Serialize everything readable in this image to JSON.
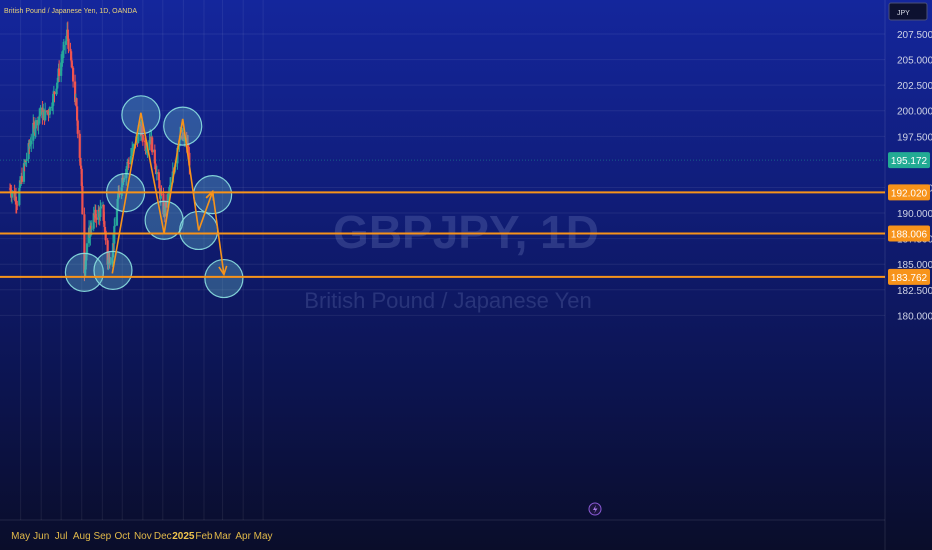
{
  "title": "British Pound / Japanese Yen, 1D, OANDA",
  "watermark": {
    "symbol": "GBPJPY, 1D",
    "name": "British Pound / Japanese Yen"
  },
  "currency_button": "JPY",
  "colors": {
    "up": "#26a69a",
    "down": "#ef5350",
    "level": "#f7931a",
    "current": "#22ab94",
    "circle_fill": "rgba(102,190,200,0.35)",
    "circle_stroke": "rgba(140,225,225,0.9)"
  },
  "chart_data": {
    "type": "candlestick",
    "symbol": "GBPJPY",
    "interval": "1D",
    "source": "OANDA",
    "x_start": "2024-04-15",
    "x_ticks": [
      "May",
      "Jun",
      "Jul",
      "Aug",
      "Sep",
      "Oct",
      "Nov",
      "Dec",
      "2025",
      "Feb",
      "Mar",
      "Apr",
      "May"
    ],
    "y_ticks": [
      "207.500",
      "205.000",
      "202.500",
      "200.000",
      "197.500",
      "192.500",
      "190.000",
      "187.500",
      "185.000",
      "182.500",
      "180.000"
    ],
    "ylim": [
      179.0,
      209.0
    ],
    "current_price": {
      "value": 195.172,
      "label": "195.172"
    },
    "levels": [
      {
        "value": 192.02,
        "label": "192.020"
      },
      {
        "value": 188.006,
        "label": "188.006"
      },
      {
        "value": 183.762,
        "label": "183.762"
      }
    ],
    "price_path": [
      [
        "2024-04-15",
        192.4
      ],
      [
        "2024-04-26",
        191.2
      ],
      [
        "2024-05-03",
        193.6
      ],
      [
        "2024-05-10",
        195.4
      ],
      [
        "2024-05-20",
        198.2
      ],
      [
        "2024-05-31",
        199.8
      ],
      [
        "2024-06-07",
        199.6
      ],
      [
        "2024-06-14",
        200.2
      ],
      [
        "2024-06-21",
        201.8
      ],
      [
        "2024-06-28",
        203.9
      ],
      [
        "2024-07-05",
        205.8
      ],
      [
        "2024-07-10",
        207.6
      ],
      [
        "2024-07-17",
        204.2
      ],
      [
        "2024-07-24",
        200.0
      ],
      [
        "2024-07-31",
        194.0
      ],
      [
        "2024-08-05",
        184.6
      ],
      [
        "2024-08-12",
        188.0
      ],
      [
        "2024-08-19",
        189.6
      ],
      [
        "2024-08-26",
        190.0
      ],
      [
        "2024-09-02",
        190.3
      ],
      [
        "2024-09-09",
        185.2
      ],
      [
        "2024-09-16",
        186.2
      ],
      [
        "2024-09-24",
        191.2
      ],
      [
        "2024-10-01",
        193.4
      ],
      [
        "2024-10-08",
        194.6
      ],
      [
        "2024-10-15",
        195.8
      ],
      [
        "2024-10-22",
        197.2
      ],
      [
        "2024-10-29",
        198.2
      ],
      [
        "2024-11-05",
        196.6
      ],
      [
        "2024-11-12",
        197.6
      ],
      [
        "2024-11-19",
        195.2
      ],
      [
        "2024-11-26",
        192.2
      ],
      [
        "2024-12-03",
        190.0
      ],
      [
        "2024-12-10",
        191.8
      ],
      [
        "2024-12-17",
        194.0
      ],
      [
        "2024-12-24",
        197.0
      ],
      [
        "2024-12-31",
        197.3
      ],
      [
        "2025-01-07",
        196.5
      ],
      [
        "2025-01-10",
        195.172
      ]
    ],
    "projection_path": [
      [
        "2024-09-16",
        184.1
      ],
      [
        "2024-10-29",
        199.8
      ],
      [
        "2024-12-03",
        188.0
      ],
      [
        "2024-12-31",
        199.2
      ],
      [
        "2025-01-24",
        188.3
      ],
      [
        "2025-02-14",
        192.1
      ],
      [
        "2025-03-03",
        184.0
      ]
    ],
    "highlight_circles": [
      {
        "date": "2024-08-05",
        "value": 184.2
      },
      {
        "date": "2024-09-17",
        "value": 184.4
      },
      {
        "date": "2024-10-06",
        "value": 192.0
      },
      {
        "date": "2024-10-29",
        "value": 199.6
      },
      {
        "date": "2024-12-03",
        "value": 189.3
      },
      {
        "date": "2024-12-31",
        "value": 198.5
      },
      {
        "date": "2025-01-24",
        "value": 188.3
      },
      {
        "date": "2025-02-14",
        "value": 191.8
      },
      {
        "date": "2025-03-03",
        "value": 183.6
      }
    ]
  }
}
